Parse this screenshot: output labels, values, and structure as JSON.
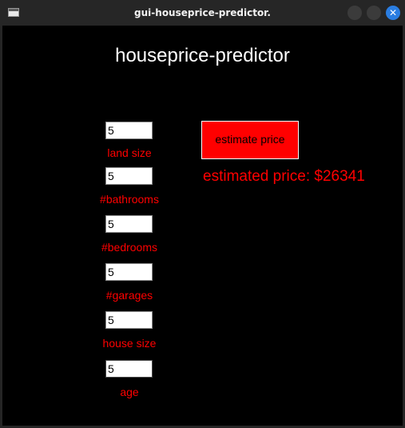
{
  "window": {
    "title": "gui-houseprice-predictor.",
    "close_glyph": "✕"
  },
  "app": {
    "heading": "houseprice-predictor",
    "fields": [
      {
        "value": "5",
        "label": "land size"
      },
      {
        "value": "5",
        "label": "#bathrooms"
      },
      {
        "value": "5",
        "label": "#bedrooms"
      },
      {
        "value": "5",
        "label": "#garages"
      },
      {
        "value": "5",
        "label": "house size"
      },
      {
        "value": "5",
        "label": "age"
      }
    ],
    "estimate_button_label": "estimate price",
    "result_text": "estimated price: $26341"
  },
  "colors": {
    "accent": "#ff0000",
    "background": "#000000",
    "close_button": "#2a7de1"
  }
}
